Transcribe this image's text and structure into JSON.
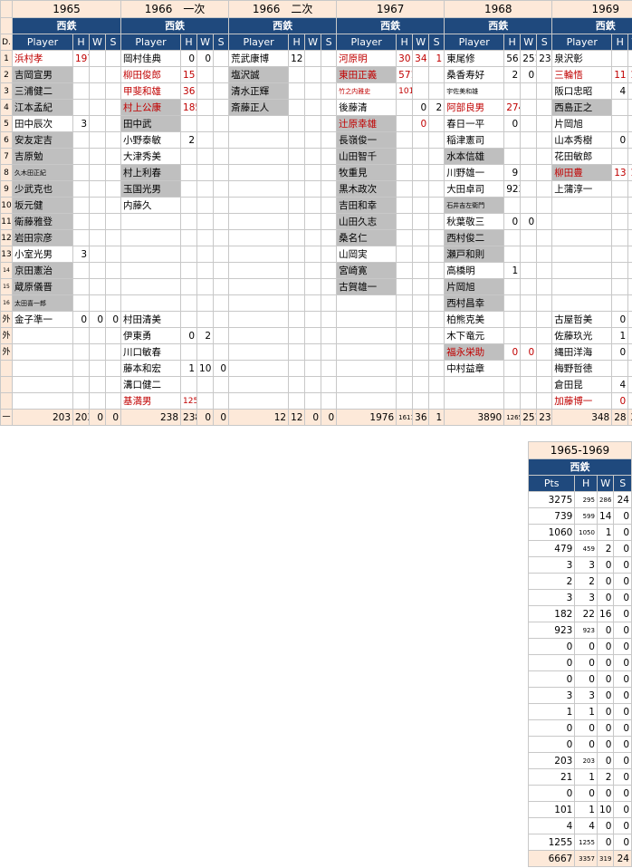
{
  "seasons": [
    {
      "year": "1965"
    },
    {
      "year": "1966　一次"
    },
    {
      "year": "1966　二次"
    },
    {
      "year": "1967"
    },
    {
      "year": "1968"
    },
    {
      "year": "1969"
    }
  ],
  "team": "西鉄",
  "headers": {
    "d": "D.",
    "player": "Player",
    "h": "H",
    "w": "W",
    "s": "S",
    "pts": "Pts"
  },
  "row_labels": [
    "1",
    "2",
    "3",
    "4",
    "5",
    "6",
    "7",
    "8",
    "9",
    "10",
    "11",
    "12",
    "13",
    "14",
    "15",
    "16",
    "外",
    "外",
    "外",
    "",
    "",
    "",
    "一"
  ],
  "rows": [
    [
      {
        "n": "浜村孝",
        "h": "197",
        "r": 1
      },
      {
        "n": "岡村佳典",
        "h": "0",
        "w": "0"
      },
      {
        "n": "荒武康博",
        "h": "12"
      },
      {
        "n": "河原明",
        "h": "30",
        "w": "34",
        "s": "1",
        "r": 1
      },
      {
        "n": "東尾修",
        "h": "56",
        "w": "251",
        "s": "23"
      },
      {
        "n": "泉沢彰",
        "w": "0",
        "s": "1"
      }
    ],
    [
      {
        "n": "吉岡宣男",
        "g": 1
      },
      {
        "n": "柳田俊郎",
        "h": "15",
        "r": 1
      },
      {
        "n": "塩沢誠",
        "g": 1
      },
      {
        "n": "東田正義",
        "h": "571",
        "r": 1,
        "g": 1
      },
      {
        "n": "桑香寿好",
        "h": "2",
        "w": "0"
      },
      {
        "n": "三輪悟",
        "h": "11",
        "w": "14",
        "s": "0",
        "r": 1
      }
    ],
    [
      {
        "n": "三浦健二",
        "g": 1
      },
      {
        "n": "甲斐和雄",
        "h": "36",
        "r": 1
      },
      {
        "n": "清水正輝",
        "g": 1
      },
      {
        "n": "竹之内雅史",
        "h": "1010",
        "r": 1
      },
      {
        "n": "宇佐美和雄"
      },
      {
        "n": "阪口忠昭",
        "h": "4",
        "w": "1"
      }
    ],
    [
      {
        "n": "江本孟紀",
        "g": 1
      },
      {
        "n": "村上公康",
        "h": "185",
        "r": 1,
        "g": 1
      },
      {
        "n": "斎藤正人",
        "g": 1
      },
      {
        "n": "後藤清",
        "w": "0",
        "s": "2"
      },
      {
        "n": "阿部良男",
        "h": "274",
        "r": 1
      },
      {
        "n": "西島正之",
        "g": 1
      }
    ],
    [
      {
        "n": "田中辰次",
        "h": "3"
      },
      {
        "n": "田中武",
        "g": 1
      },
      {},
      {
        "n": "辻原幸雄",
        "w": "0",
        "r": 1,
        "g": 1
      },
      {
        "n": "春日一平",
        "h": "0"
      },
      {
        "n": "片岡旭"
      }
    ],
    [
      {
        "n": "安友定吉",
        "g": 1
      },
      {
        "n": "小野泰敏",
        "h": "2"
      },
      {},
      {
        "n": "長嶺俊一",
        "g": 1
      },
      {
        "n": "稲津憲司"
      },
      {
        "n": "山本秀樹",
        "h": "0",
        "w": "0"
      }
    ],
    [
      {
        "n": "吉原勉",
        "g": 1
      },
      {
        "n": "大津秀美"
      },
      {},
      {
        "n": "山田智千",
        "g": 1
      },
      {
        "n": "水本信雄",
        "g": 1
      },
      {
        "n": "花田敏郎"
      }
    ],
    [
      {
        "n": "久木田正紀",
        "g": 1
      },
      {
        "n": "村上利春",
        "g": 1
      },
      {},
      {
        "n": "牧重見",
        "g": 1
      },
      {
        "n": "川野雄一",
        "h": "9"
      },
      {
        "n": "柳田豊",
        "h": "13",
        "w": "16",
        "r": 1,
        "g": 1
      }
    ],
    [
      {
        "n": "少武克也",
        "g": 1
      },
      {
        "n": "玉国光男",
        "g": 1
      },
      {},
      {
        "n": "黒木政次",
        "g": 1
      },
      {
        "n": "大田卓司",
        "h": "923"
      },
      {
        "n": "上蒲淳一"
      }
    ],
    [
      {
        "n": "坂元健",
        "g": 1
      },
      {
        "n": "内藤久"
      },
      {},
      {
        "n": "吉田和幸",
        "g": 1
      },
      {
        "n": "石井吉左衛門",
        "g": 1
      }
    ],
    [
      {
        "n": "衛藤雅登",
        "g": 1
      },
      {},
      {},
      {
        "n": "山田久志",
        "g": 1
      },
      {
        "n": "秋葉敬三",
        "h": "0",
        "w": "0"
      }
    ],
    [
      {
        "n": "岩田宗彦",
        "g": 1
      },
      {},
      {},
      {
        "n": "桑名仁",
        "g": 1
      },
      {
        "n": "西村俊二",
        "g": 1
      }
    ],
    [
      {
        "n": "小室光男",
        "h": "3"
      },
      {},
      {},
      {
        "n": "山岡実"
      },
      {
        "n": "瀬戸和則",
        "g": 1
      }
    ],
    [
      {
        "n": "京田憲治",
        "g": 1
      },
      {},
      {},
      {
        "n": "宮崎寛",
        "g": 1
      },
      {
        "n": "高橋明",
        "h": "1"
      }
    ],
    [
      {
        "n": "蔵原儀晋",
        "g": 1
      },
      {},
      {},
      {
        "n": "古賀雄一",
        "g": 1
      },
      {
        "n": "片岡旭",
        "g": 1
      }
    ],
    [
      {
        "n": "太田喜一郎",
        "g": 1
      },
      {},
      {},
      {},
      {
        "n": "西村昌幸",
        "g": 1
      }
    ],
    [
      {
        "n": "金子準一",
        "h": "0",
        "w": "0",
        "s": "0"
      },
      {
        "n": "村田清美"
      },
      {},
      {},
      {
        "n": "柏熊克美"
      },
      {
        "n": "古屋哲美",
        "h": "0",
        "w": "0",
        "s": "0"
      }
    ],
    [
      {},
      {
        "n": "伊東勇",
        "h": "0",
        "w": "2"
      },
      {},
      {},
      {
        "n": "木下竜元"
      },
      {
        "n": "佐藤玖光",
        "h": "1",
        "w": "0",
        "s": "0"
      }
    ],
    [
      {},
      {
        "n": "川口敏春"
      },
      {},
      {},
      {
        "n": "福永栄助",
        "h": "0",
        "w": "0",
        "r": 1,
        "g": 1
      },
      {
        "n": "縄田洋海",
        "h": "0",
        "w": "0",
        "s": "0"
      }
    ],
    [
      {},
      {
        "n": "藤本和宏",
        "h": "1",
        "w": "10",
        "s": "0"
      },
      {},
      {},
      {
        "n": "中村益章"
      },
      {
        "n": "梅野哲徳"
      }
    ],
    [
      {},
      {
        "n": "溝口健二"
      },
      {},
      {},
      {},
      {
        "n": "倉田昆",
        "h": "4"
      }
    ],
    [
      {},
      {
        "n": "基満男",
        "h": "1255",
        "r": 1
      },
      {},
      {},
      {},
      {
        "n": "加藤博一",
        "h": "0",
        "r": 1
      }
    ]
  ],
  "season_totals": [
    {
      "pts": "203",
      "h": "203",
      "w": "0",
      "s": "0"
    },
    {
      "pts": "238",
      "h": "238",
      "w": "0",
      "s": "0"
    },
    {
      "pts": "12",
      "h": "12",
      "w": "0",
      "s": "0"
    },
    {
      "pts": "1976",
      "h": "1611",
      "w": "36",
      "s": "1"
    },
    {
      "pts": "3890",
      "h": "1265",
      "w": "251",
      "s": "23"
    },
    {
      "pts": "348",
      "h": "28",
      "w": "32",
      "s": "0"
    }
  ],
  "totals": {
    "title": "1965-1969",
    "rows": [
      [
        "3275",
        "295",
        "286",
        "24"
      ],
      [
        "739",
        "599",
        "14",
        "0"
      ],
      [
        "1060",
        "1050",
        "1",
        "0"
      ],
      [
        "479",
        "459",
        "2",
        "0"
      ],
      [
        "3",
        "3",
        "0",
        "0"
      ],
      [
        "2",
        "2",
        "0",
        "0"
      ],
      [
        "3",
        "3",
        "0",
        "0"
      ],
      [
        "182",
        "22",
        "16",
        "0"
      ],
      [
        "923",
        "923",
        "0",
        "0"
      ],
      [
        "0",
        "0",
        "0",
        "0"
      ],
      [
        "0",
        "0",
        "0",
        "0"
      ],
      [
        "0",
        "0",
        "0",
        "0"
      ],
      [
        "3",
        "3",
        "0",
        "0"
      ],
      [
        "1",
        "1",
        "0",
        "0"
      ],
      [
        "0",
        "0",
        "0",
        "0"
      ],
      [
        "0",
        "0",
        "0",
        "0"
      ],
      [
        "203",
        "203",
        "0",
        "0"
      ],
      [
        "21",
        "1",
        "2",
        "0"
      ],
      [
        "0",
        "0",
        "0",
        "0"
      ],
      [
        "101",
        "1",
        "10",
        "0"
      ],
      [
        "4",
        "4",
        "0",
        "0"
      ],
      [
        "1255",
        "1255",
        "0",
        "0"
      ]
    ],
    "grand": [
      "6667",
      "3357",
      "319",
      "24"
    ]
  }
}
